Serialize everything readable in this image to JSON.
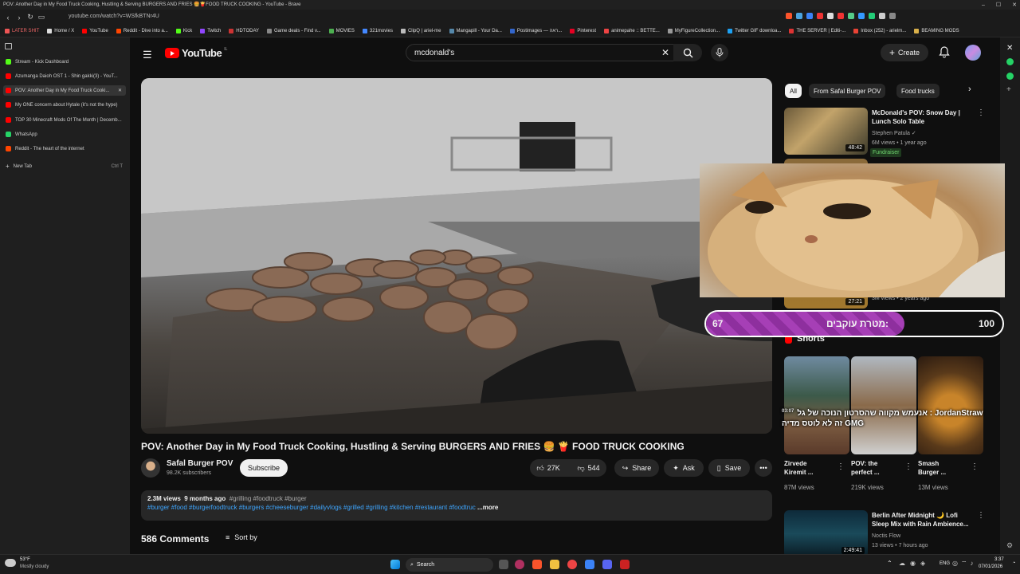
{
  "window": {
    "title": "POV: Another Day in My Food Truck Cooking, Hustling & Serving BURGERS AND FRIES 🍔🍟FOOD TRUCK COOKING - YouTube - Brave",
    "controls": [
      "–",
      "☐",
      "✕"
    ]
  },
  "address_bar": {
    "url": "youtube.com/watch?v=WSfkBTNr4U"
  },
  "bookmarks": [
    {
      "label": "LATER SHIT",
      "color": "#e55"
    },
    {
      "label": "Home / X",
      "color": "#ddd"
    },
    {
      "label": "YouTube",
      "color": "#f00"
    },
    {
      "label": "Reddit - Dive into a...",
      "color": "#ff4500"
    },
    {
      "label": "Kick",
      "color": "#53fc18"
    },
    {
      "label": "Twitch",
      "color": "#9146ff"
    },
    {
      "label": "HDTODAY",
      "color": "#c33"
    },
    {
      "label": "Game deals - Find v...",
      "color": "#888"
    },
    {
      "label": "MOVIES",
      "color": "#4caf50"
    },
    {
      "label": "321movies",
      "color": "#4488ff"
    },
    {
      "label": "ClipQ | ariel-me",
      "color": "#bbb"
    },
    {
      "label": "Mangapill - Your Da...",
      "color": "#58a"
    },
    {
      "label": "Postimages — ראה...",
      "color": "#36c"
    },
    {
      "label": "Pinterest",
      "color": "#e60023"
    },
    {
      "label": "animepahe :: BETTE...",
      "color": "#e44"
    },
    {
      "label": "MyFigureCollection...",
      "color": "#999"
    },
    {
      "label": "Twitter GIF downloa...",
      "color": "#1da1f2"
    },
    {
      "label": "THE SERVER | Editi-...",
      "color": "#d33"
    },
    {
      "label": "Inbox (252) - arielm...",
      "color": "#ea4335"
    },
    {
      "label": "BEAMING MODS",
      "color": "#d9b04a"
    }
  ],
  "sidebar_tabs": [
    {
      "label": "Stream - Kick Dashboard",
      "color": "#53fc18",
      "active": false
    },
    {
      "label": "Azumanga Daioh OST 1 - Shin gakki(3) - YouT...",
      "color": "#f00",
      "active": false
    },
    {
      "label": "POV: Another Day in My Food Truck Cooki...",
      "color": "#f00",
      "active": true
    },
    {
      "label": "My ONE concern about Hytale (it's not the hype)",
      "color": "#f00",
      "active": false
    },
    {
      "label": "TOP 30 Minecraft Mods Of The Month | Decemb...",
      "color": "#f00",
      "active": false
    },
    {
      "label": "WhatsApp",
      "color": "#25d366",
      "active": false
    },
    {
      "label": "Reddit - The heart of the internet",
      "color": "#ff4500",
      "active": false
    }
  ],
  "new_tab": {
    "label": "New Tab",
    "shortcut": "Ctrl T"
  },
  "youtube": {
    "logo_text": "YouTube",
    "logo_region": "IL",
    "search_value": "mcdonald's",
    "create_label": "Create",
    "video": {
      "title": "POV: Another Day in My Food Truck Cooking, Hustling & Serving BURGERS AND FRIES 🍔 🍟 FOOD TRUCK COOKING",
      "channel": "Safal Burger POV",
      "subscribers": "98.2K subscribers",
      "subscribe_label": "Subscribe",
      "likes": "27K",
      "dislikes": "544",
      "share_label": "Share",
      "ask_label": "Ask",
      "save_label": "Save",
      "views": "2.3M views",
      "age": "9 months ago",
      "hashtags_line1": "#grilling #foodtruck #burger",
      "hashtags_line2": "#burger #food #burgerfoodtruck #burgers #cheeseburger #dailyvlogs #grilled #grilling #kitchen #restaurant #foodtruc",
      "more_label": "...more",
      "comments_count": "586 Comments",
      "sort_label": "Sort by"
    },
    "chips": [
      {
        "label": "All",
        "selected": true
      },
      {
        "label": "From Safal Burger POV",
        "selected": false
      },
      {
        "label": "Food trucks",
        "selected": false
      }
    ],
    "recommendations": [
      {
        "title1": "McDonald's POV: Snow Day |",
        "title2": "Lunch Solo Table",
        "channel": "Stephen Patula ✓",
        "meta": "6M views • 1 year ago",
        "badge": "Fundraiser",
        "duration": "48:42"
      },
      {
        "duration": "27:21",
        "meta": "3M views • 2 years ago"
      },
      {
        "title1": "Berlin After Midnight 🌙 Lofi",
        "title2": "Sleep Mix with Rain Ambience...",
        "channel": "Noctis Flow",
        "meta": "13 views • 7 hours ago",
        "duration": "2:49:41"
      }
    ],
    "shorts_heading": "Shorts",
    "shorts": [
      {
        "title1": "Zirvede",
        "title2": "Kiremit ...",
        "views": "87M views"
      },
      {
        "title1": "POV: the",
        "title2": "perfect ...",
        "views": "219K views"
      },
      {
        "title1": "Smash",
        "title2": "Burger ...",
        "views": "13M views"
      }
    ]
  },
  "overlays": {
    "goal_label": "מטרת עוקבים:",
    "goal_current": "67",
    "goal_target": "100",
    "goal_fraction": 0.67,
    "chat_line1": "אנעמש מקווה שהסרטון הנוכה של גל : JordanStraw",
    "chat_line2": "זה לא לוטס מדיה GMG",
    "chat_time": "03:07"
  },
  "taskbar": {
    "weather_temp": "53°F",
    "weather_desc": "Mostly cloudy",
    "search_label": "Search",
    "lang": "ENG",
    "time": "3:37",
    "date": "07/01/2026"
  }
}
